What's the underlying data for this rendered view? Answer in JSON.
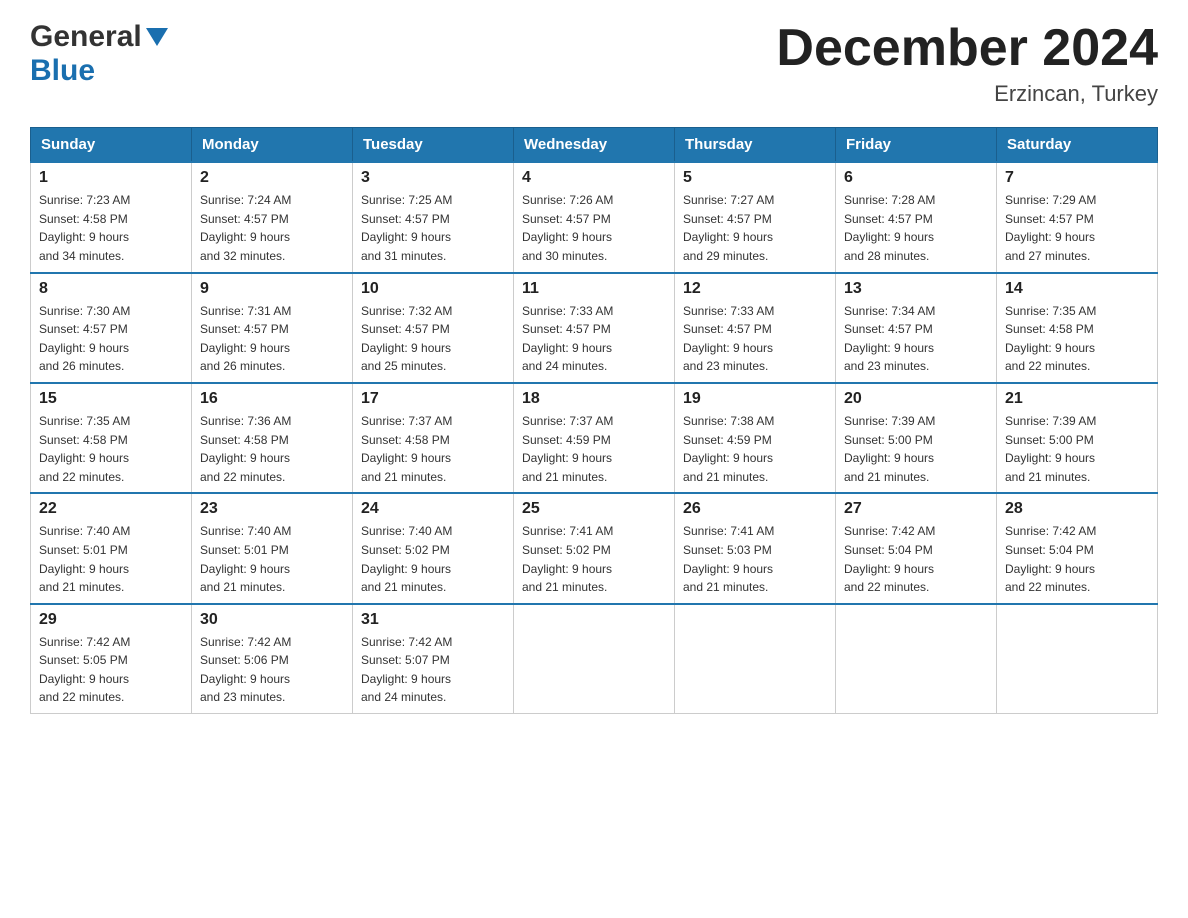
{
  "header": {
    "logo_line1": "General",
    "logo_line2": "Blue",
    "calendar_title": "December 2024",
    "calendar_subtitle": "Erzincan, Turkey"
  },
  "days_of_week": [
    "Sunday",
    "Monday",
    "Tuesday",
    "Wednesday",
    "Thursday",
    "Friday",
    "Saturday"
  ],
  "weeks": [
    [
      {
        "day": "1",
        "sunrise": "7:23 AM",
        "sunset": "4:58 PM",
        "daylight": "9 hours and 34 minutes."
      },
      {
        "day": "2",
        "sunrise": "7:24 AM",
        "sunset": "4:57 PM",
        "daylight": "9 hours and 32 minutes."
      },
      {
        "day": "3",
        "sunrise": "7:25 AM",
        "sunset": "4:57 PM",
        "daylight": "9 hours and 31 minutes."
      },
      {
        "day": "4",
        "sunrise": "7:26 AM",
        "sunset": "4:57 PM",
        "daylight": "9 hours and 30 minutes."
      },
      {
        "day": "5",
        "sunrise": "7:27 AM",
        "sunset": "4:57 PM",
        "daylight": "9 hours and 29 minutes."
      },
      {
        "day": "6",
        "sunrise": "7:28 AM",
        "sunset": "4:57 PM",
        "daylight": "9 hours and 28 minutes."
      },
      {
        "day": "7",
        "sunrise": "7:29 AM",
        "sunset": "4:57 PM",
        "daylight": "9 hours and 27 minutes."
      }
    ],
    [
      {
        "day": "8",
        "sunrise": "7:30 AM",
        "sunset": "4:57 PM",
        "daylight": "9 hours and 26 minutes."
      },
      {
        "day": "9",
        "sunrise": "7:31 AM",
        "sunset": "4:57 PM",
        "daylight": "9 hours and 26 minutes."
      },
      {
        "day": "10",
        "sunrise": "7:32 AM",
        "sunset": "4:57 PM",
        "daylight": "9 hours and 25 minutes."
      },
      {
        "day": "11",
        "sunrise": "7:33 AM",
        "sunset": "4:57 PM",
        "daylight": "9 hours and 24 minutes."
      },
      {
        "day": "12",
        "sunrise": "7:33 AM",
        "sunset": "4:57 PM",
        "daylight": "9 hours and 23 minutes."
      },
      {
        "day": "13",
        "sunrise": "7:34 AM",
        "sunset": "4:57 PM",
        "daylight": "9 hours and 23 minutes."
      },
      {
        "day": "14",
        "sunrise": "7:35 AM",
        "sunset": "4:58 PM",
        "daylight": "9 hours and 22 minutes."
      }
    ],
    [
      {
        "day": "15",
        "sunrise": "7:35 AM",
        "sunset": "4:58 PM",
        "daylight": "9 hours and 22 minutes."
      },
      {
        "day": "16",
        "sunrise": "7:36 AM",
        "sunset": "4:58 PM",
        "daylight": "9 hours and 22 minutes."
      },
      {
        "day": "17",
        "sunrise": "7:37 AM",
        "sunset": "4:58 PM",
        "daylight": "9 hours and 21 minutes."
      },
      {
        "day": "18",
        "sunrise": "7:37 AM",
        "sunset": "4:59 PM",
        "daylight": "9 hours and 21 minutes."
      },
      {
        "day": "19",
        "sunrise": "7:38 AM",
        "sunset": "4:59 PM",
        "daylight": "9 hours and 21 minutes."
      },
      {
        "day": "20",
        "sunrise": "7:39 AM",
        "sunset": "5:00 PM",
        "daylight": "9 hours and 21 minutes."
      },
      {
        "day": "21",
        "sunrise": "7:39 AM",
        "sunset": "5:00 PM",
        "daylight": "9 hours and 21 minutes."
      }
    ],
    [
      {
        "day": "22",
        "sunrise": "7:40 AM",
        "sunset": "5:01 PM",
        "daylight": "9 hours and 21 minutes."
      },
      {
        "day": "23",
        "sunrise": "7:40 AM",
        "sunset": "5:01 PM",
        "daylight": "9 hours and 21 minutes."
      },
      {
        "day": "24",
        "sunrise": "7:40 AM",
        "sunset": "5:02 PM",
        "daylight": "9 hours and 21 minutes."
      },
      {
        "day": "25",
        "sunrise": "7:41 AM",
        "sunset": "5:02 PM",
        "daylight": "9 hours and 21 minutes."
      },
      {
        "day": "26",
        "sunrise": "7:41 AM",
        "sunset": "5:03 PM",
        "daylight": "9 hours and 21 minutes."
      },
      {
        "day": "27",
        "sunrise": "7:42 AM",
        "sunset": "5:04 PM",
        "daylight": "9 hours and 22 minutes."
      },
      {
        "day": "28",
        "sunrise": "7:42 AM",
        "sunset": "5:04 PM",
        "daylight": "9 hours and 22 minutes."
      }
    ],
    [
      {
        "day": "29",
        "sunrise": "7:42 AM",
        "sunset": "5:05 PM",
        "daylight": "9 hours and 22 minutes."
      },
      {
        "day": "30",
        "sunrise": "7:42 AM",
        "sunset": "5:06 PM",
        "daylight": "9 hours and 23 minutes."
      },
      {
        "day": "31",
        "sunrise": "7:42 AM",
        "sunset": "5:07 PM",
        "daylight": "9 hours and 24 minutes."
      },
      null,
      null,
      null,
      null
    ]
  ],
  "labels": {
    "sunrise": "Sunrise:",
    "sunset": "Sunset:",
    "daylight": "Daylight:"
  }
}
